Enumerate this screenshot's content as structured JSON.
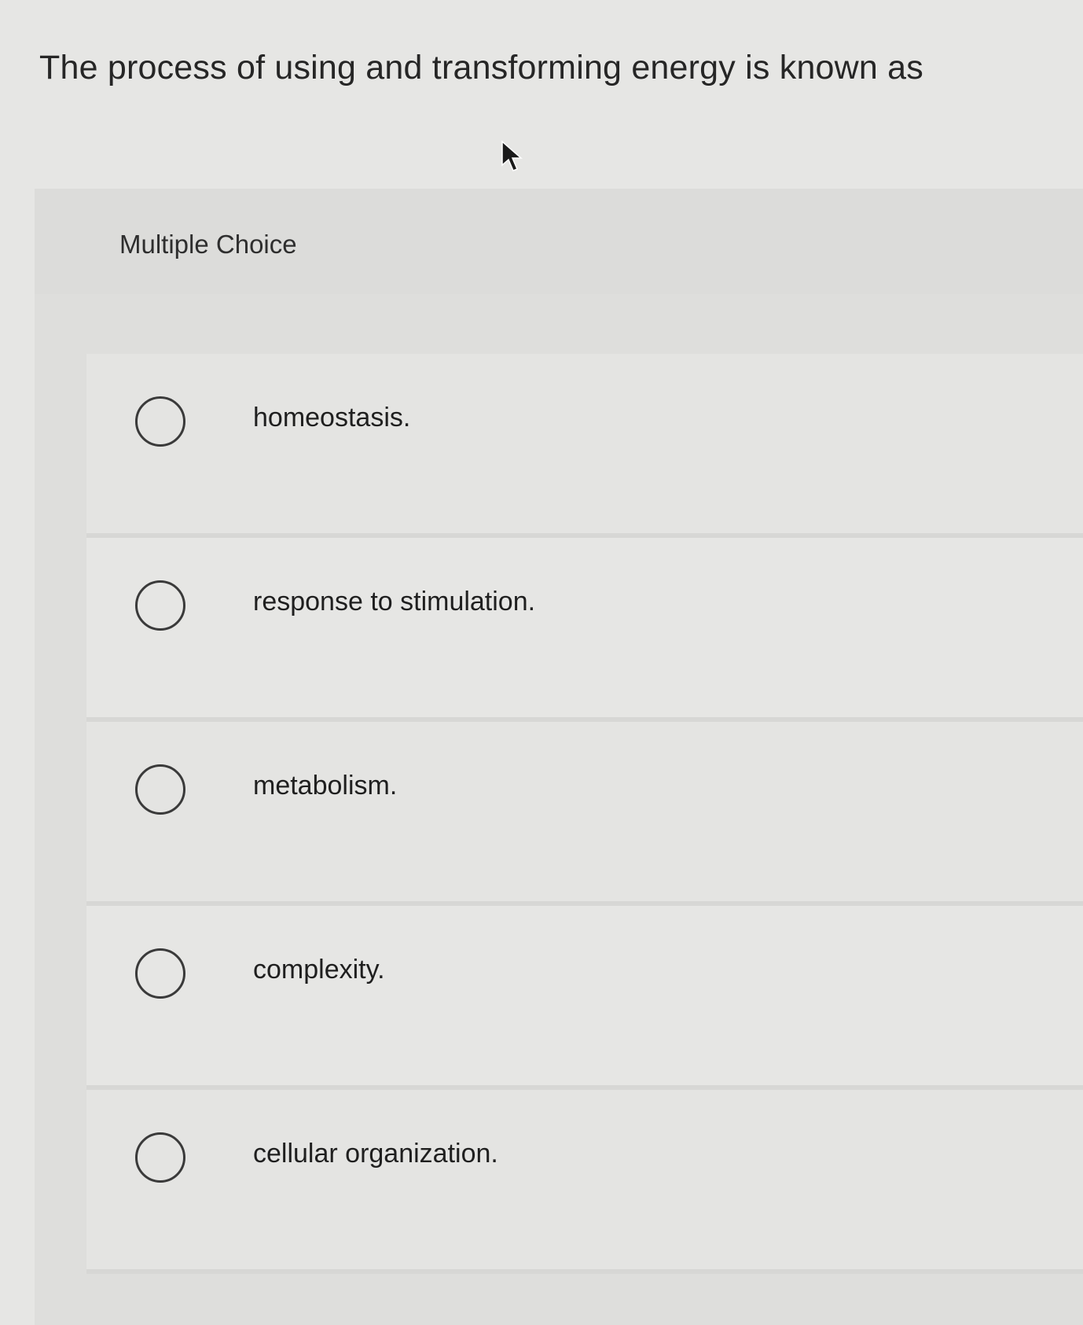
{
  "question": {
    "text": "The process of using and transforming energy is known as"
  },
  "panel": {
    "title": "Multiple Choice"
  },
  "options": [
    {
      "label": "homeostasis."
    },
    {
      "label": "response to stimulation."
    },
    {
      "label": "metabolism."
    },
    {
      "label": "complexity."
    },
    {
      "label": "cellular organization."
    }
  ],
  "icons": {
    "cursor": "mouse-pointer-icon",
    "radio": "radio-circle-icon"
  },
  "colors": {
    "background": "#e6e6e4",
    "text": "#262626",
    "radio_border": "#3a3a3a"
  }
}
